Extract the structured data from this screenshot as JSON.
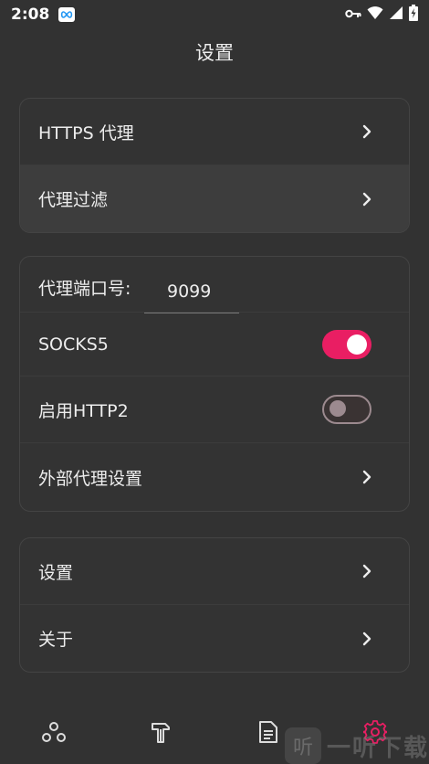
{
  "status_bar": {
    "time": "2:08",
    "icons": [
      "infinity-app-icon",
      "vpn-key-icon",
      "wifi-icon",
      "signal-icon",
      "battery-charging-icon"
    ]
  },
  "header": {
    "title": "设置"
  },
  "card1": {
    "items": [
      {
        "label": "HTTPS 代理"
      },
      {
        "label": "代理过滤"
      }
    ]
  },
  "card2": {
    "port_label": "代理端口号:",
    "port_value": "9099",
    "socks5_label": "SOCKS5",
    "socks5_enabled": true,
    "http2_label": "启用HTTP2",
    "http2_enabled": false,
    "external_proxy_label": "外部代理设置"
  },
  "card3": {
    "items": [
      {
        "label": "设置"
      },
      {
        "label": "关于"
      }
    ]
  },
  "bottom_nav": {
    "items": [
      "network-icon",
      "tools-icon",
      "document-icon",
      "settings-gear-icon"
    ],
    "active_index": 3,
    "accent_color": "#E91E63"
  },
  "watermark": {
    "char": "听",
    "text": "一听下载"
  },
  "colors": {
    "background": "#323232",
    "card": "#333333",
    "accent": "#E91E63"
  }
}
